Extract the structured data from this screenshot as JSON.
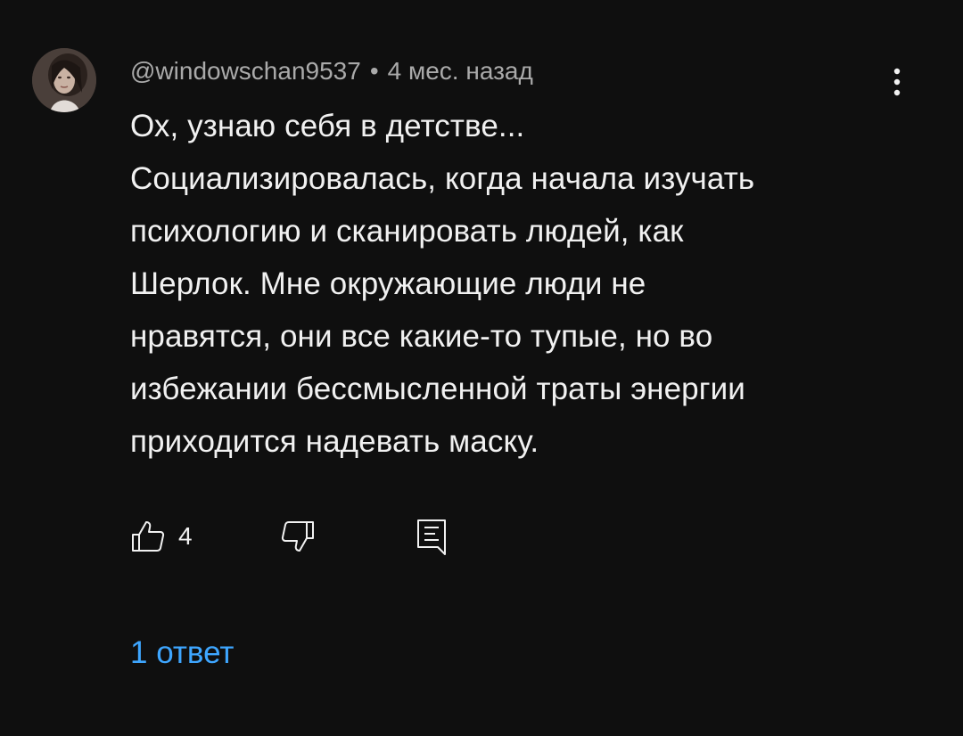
{
  "comment": {
    "author": "@windowschan9537",
    "separator": "•",
    "time": "4 мес. назад",
    "text_lines": [
      "Ох, узнаю себя в детстве...",
      "Социализировалась, когда начала изучать",
      "психологию и сканировать людей, как",
      "Шерлок. Мне окружающие люди не",
      "нравятся, они все какие-то тупые, но во",
      "избежании бессмысленной траты энергии",
      "приходится надевать маску."
    ],
    "likes": "4",
    "replies_label": "1 ответ"
  },
  "icons": {
    "menu": "more-vertical-icon",
    "like": "thumbs-up-icon",
    "dislike": "thumbs-down-icon",
    "reply": "reply-comment-icon"
  },
  "colors": {
    "background": "#0f0f0f",
    "text": "#f1f1f1",
    "meta": "#aaaaaa",
    "link": "#3ea6ff"
  }
}
